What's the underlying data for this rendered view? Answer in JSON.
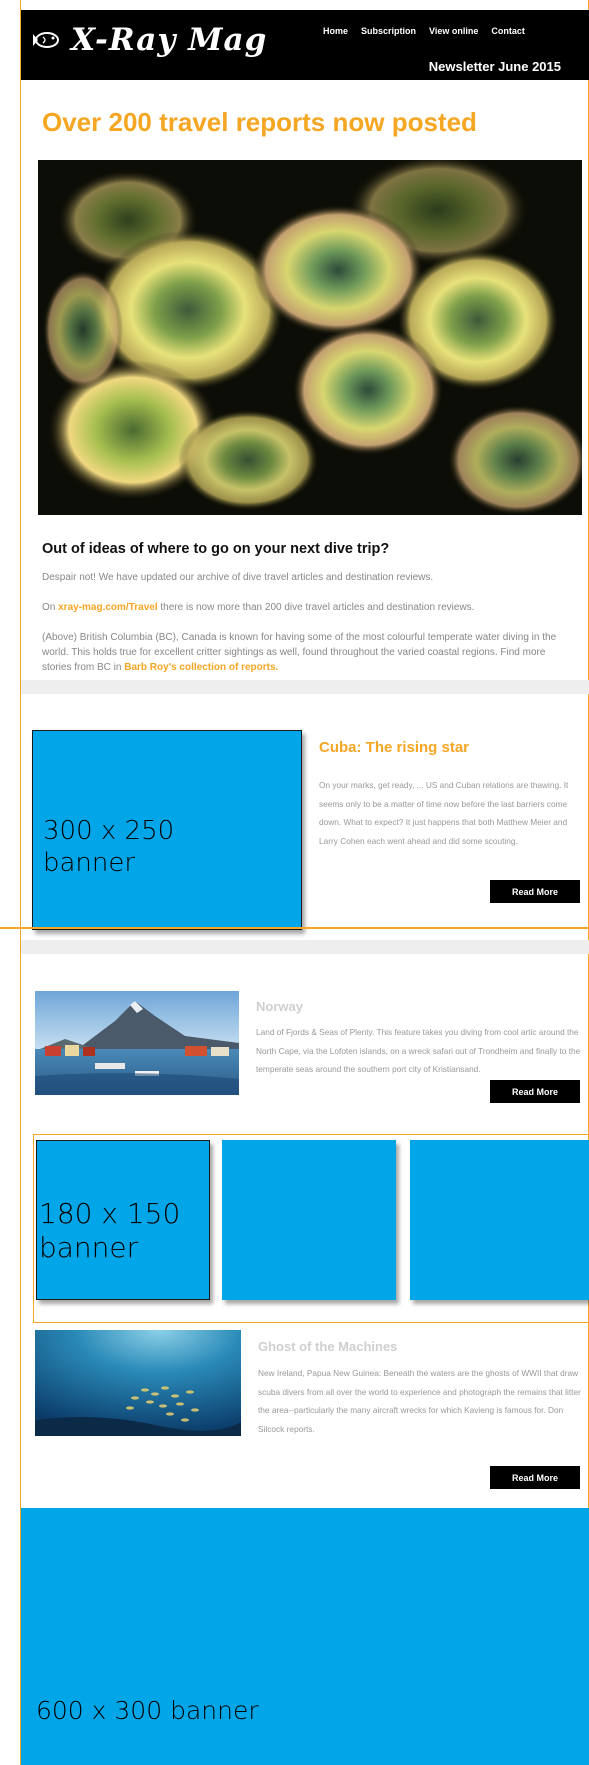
{
  "header": {
    "logo_text": "X-Ray Mag",
    "nav": [
      "Home",
      "Subscription",
      "View online",
      "Contact"
    ],
    "issue": "Newsletter June 2015"
  },
  "hero": {
    "title": "Over 200 travel reports now posted",
    "image_subject": "sea-anemones-photo",
    "lead_title": "Out of ideas of where to go on your next dive trip?",
    "p1": "Despair not! We have updated our archive of dive travel articles and destination reviews.",
    "p2_prefix": "On ",
    "p2_link": "xray-mag.com/Travel",
    "p2_suffix": " there is now more than 200 dive travel articles and destination reviews.",
    "p3_text": "(Above) British Columbia (BC), Canada is known for having some of the most colourful temperate water diving in the world. This holds true for excellent critter sightings as well, found throughout the varied coastal regions. Find more stories from BC in ",
    "p3_link": "Barb Roy's collection of reports."
  },
  "banners": {
    "b300": "300 x 250\nbanner",
    "b180": "180 x 150\nbanner",
    "b600": "600 x 300 banner",
    "color": "#00a6e8"
  },
  "articles": [
    {
      "title": "Cuba: The rising star",
      "body": "On your marks, get ready, ... US and Cuban relations are thawing. It seems only to be a matter of time now before the last barriers come down. What to expect? It just happens that both Matthew Meier and Larry Cohen each went ahead and did some scouting.",
      "button": "Read More"
    },
    {
      "title": "Norway",
      "body": "Land of Fjords & Seas of Plenty. This feature takes you diving from cool artic around the North Cape, via the Lofoten islands, on a wreck safari out of Trondheim and finally to the temperate seas around the southern port city of Kristiansand.",
      "button": "Read More",
      "image_subject": "norway-harbour-photo"
    },
    {
      "title": "Ghost of the Machines",
      "body": "New Ireland, Papua New Guinea: Beneath the waters are the ghosts of WWII that draw scuba divers from all over the world to experience and photograph the remains that litter the area--particularly the many aircraft wrecks for which Kavieng is famous for.  Don Silcock reports.",
      "button": "Read More",
      "image_subject": "underwater-fish-school-photo"
    }
  ],
  "colors": {
    "accent": "#f5a623",
    "header_bg": "#000000",
    "button_bg": "#000000"
  }
}
